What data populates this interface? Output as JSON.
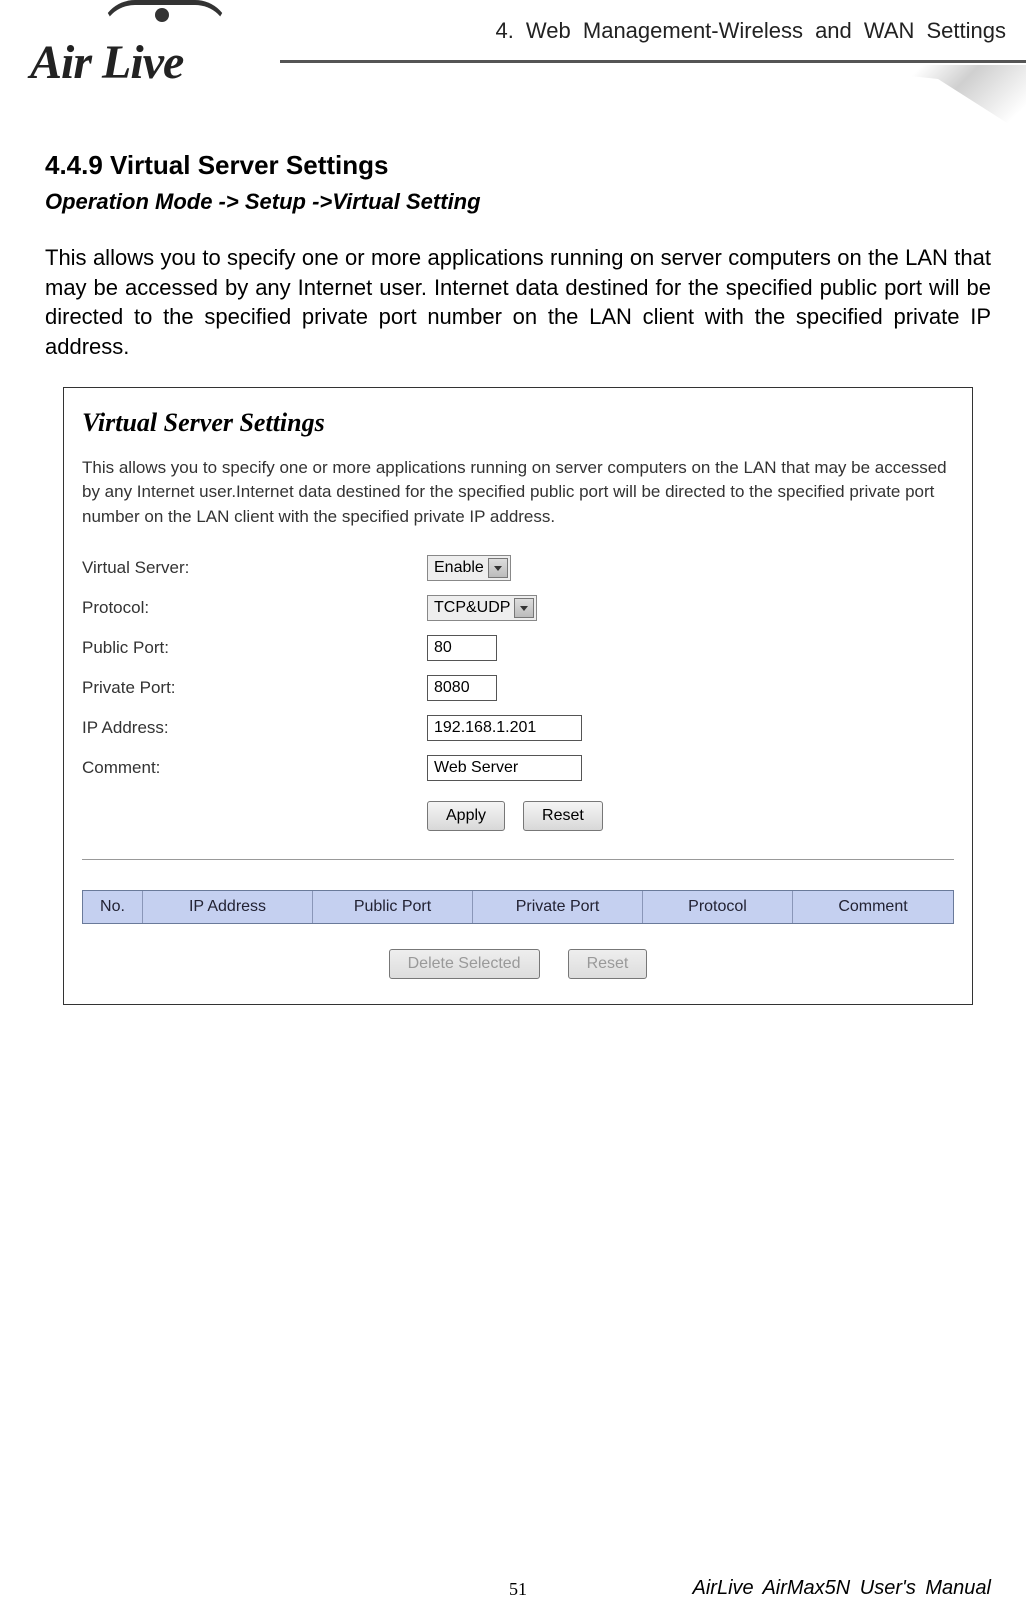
{
  "header": {
    "logo_text": "Air Live",
    "chapter": "4. Web Management-Wireless and WAN Settings"
  },
  "section": {
    "heading": "4.4.9 Virtual Server Settings",
    "breadcrumb": "Operation Mode -> Setup ->Virtual Setting",
    "intro": "This allows you to specify one or more applications running on server computers on the LAN that may be accessed by any Internet user. Internet data destined for the specified public port will be directed to the specified private port number on the LAN client with the specified private IP address."
  },
  "panel": {
    "title": "Virtual Server Settings",
    "desc": "This allows you to specify one or more applications running on server computers on the LAN that may be accessed by any Internet user.Internet data destined for the specified public port will be directed to the specified private port number on the LAN client with the specified private IP address.",
    "fields": {
      "virtual_server": {
        "label": "Virtual Server:",
        "value": "Enable"
      },
      "protocol": {
        "label": "Protocol:",
        "value": "TCP&UDP"
      },
      "public_port": {
        "label": "Public Port:",
        "value": "80"
      },
      "private_port": {
        "label": "Private Port:",
        "value": "8080"
      },
      "ip_address": {
        "label": "IP Address:",
        "value": "192.168.1.201"
      },
      "comment": {
        "label": "Comment:",
        "value": "Web Server"
      }
    },
    "buttons": {
      "apply": "Apply",
      "reset": "Reset",
      "delete_selected": "Delete Selected",
      "reset2": "Reset"
    },
    "table": {
      "no": "No.",
      "ip": "IP Address",
      "public_port": "Public Port",
      "private_port": "Private Port",
      "protocol": "Protocol",
      "comment": "Comment"
    }
  },
  "footer": {
    "page": "51",
    "manual": "AirLive AirMax5N User's Manual"
  }
}
